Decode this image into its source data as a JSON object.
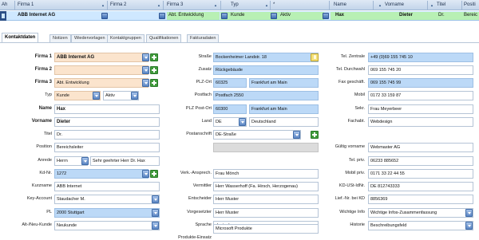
{
  "grid": {
    "columns": [
      {
        "key": "ah",
        "label": "Ah"
      },
      {
        "key": "firma1",
        "label": "Firma 1"
      },
      {
        "key": "firma2",
        "label": "Firma 2"
      },
      {
        "key": "firma3",
        "label": "Firma 3"
      },
      {
        "key": "typ",
        "label": "Typ"
      },
      {
        "key": "star",
        "label": "*"
      },
      {
        "key": "name",
        "label": "Name"
      },
      {
        "key": "vorname",
        "label": "Vorname"
      },
      {
        "key": "titel",
        "label": "Titel"
      },
      {
        "key": "position",
        "label": "Positi"
      }
    ],
    "row": {
      "firma1": "ABB Internet AG",
      "firma3": "Abt. Entwicklung",
      "typ": "Kunde",
      "status": "Aktiv",
      "name": "Hax",
      "vorname": "Dieter",
      "titel": "Dr.",
      "position": "Bereic"
    }
  },
  "tabs": [
    "Kontaktdaten",
    "Notizen",
    "Wiedervorlagen",
    "Kontaktgruppen",
    "Qualifikationen",
    "Fakturadaten"
  ],
  "form": {
    "labels": {
      "firma1": "Firma 1",
      "firma2": "Firma 2",
      "firma3": "Firma 3",
      "typ": "Typ",
      "name": "Name",
      "vorname": "Vorname",
      "titel": "Titel",
      "position": "Position",
      "anrede": "Anrede",
      "kdnr": "Kd-Nr.",
      "kurzname": "Kurzname",
      "keyaccount": "Key-Account",
      "pl": "PL",
      "altneukunde": "Alt-/Neu-Kunde",
      "strasse": "Straße",
      "zusatz": "Zusatz",
      "plzort": "PLZ-Ort",
      "postfach": "Postfach",
      "plzpostort": "PLZ Post-Ort",
      "land": "Land",
      "postanschrift": "Postanschrift",
      "verkansprech": "Verk.-Ansprech.",
      "vermittler": "Vermittler",
      "entscheider": "Entscheider",
      "vorgesetzter": "Vorgesetzter",
      "sprache": "Sprache",
      "produkteeinsatz": "Produkte-Einsatz",
      "telzentrale": "Tel. Zentrale",
      "teldurchwahl": "Tel. Durchwahl",
      "faxgeschaeft": "Fax geschäft.",
      "mobil": "Mobil",
      "sekr": "Sekr.",
      "fachabt": "Fachabt.",
      "gueltigvorname": "Gültig vorname",
      "telpriv": "Tel. priv.",
      "mobilpriv": "Mobil priv.",
      "kdustidnr": "KD-USt-IdNr.",
      "lieferdnr": "Lief.-Nr. bei KD",
      "wichtigeinfo": "Wichtige Info",
      "historie": "Historie"
    },
    "values": {
      "firma1": "ABB Internet AG",
      "firma2": "",
      "firma3": "Abt. Entwicklung",
      "typ": "Kunde",
      "status": "Aktiv",
      "name": "Hax",
      "vorname": "Dieter",
      "titel": "Dr.",
      "position": "Bereichsleiter",
      "anrede": "Herrn",
      "anrede_brief": "Sehr geehrter Herr Dr. Hax",
      "kdnr": "1272",
      "kurzname": "ABB Internet",
      "keyaccount": "Staudacher M.",
      "pl": "2000 Stuttgart",
      "altneukunde": "Neukunde",
      "strasse": "Bockenheimer Landstr. 18",
      "zusatz": "Rückgebäude",
      "plz": "60325",
      "ort": "Frankfurt am Main",
      "postfach": "Postfach 2550",
      "postplz": "60300",
      "postort": "Frankfurt am Main",
      "land_code": "DE",
      "land": "Deutschland",
      "postanschrift": "DE-Straße",
      "postanschrift_preview": "",
      "verkansprech": "Frau Mönch",
      "vermittler": "Herr Wasserhoff (Fa. Hirsch, Herzogenau)",
      "entscheider": "Herr Muster",
      "vorgesetzter": "Herr Muster",
      "sprache": "deutsch",
      "produkteeinsatz": "Microsoft Produkte",
      "telzentrale": "+49 (0)69 155 745 10",
      "teldurchwahl": "069 155 745 20",
      "faxgeschaeft": "069 155 745 99",
      "mobil": "0172 33 159 87",
      "sekr": "Frau Meyerbeer",
      "fachabt": "Webdesign",
      "gueltigvorname": "Webmaster AG",
      "telpriv": "06233 885652",
      "mobilpriv": "0171 33 22 44 55",
      "kdustidnr": "DE 812743333",
      "lieferdnr": "8856369",
      "wichtigeinfo": "Wichtige Infos-Zusammenfassung",
      "historie": "Beschreibungsfeld"
    }
  },
  "colors": {
    "header": "#c3d5ea",
    "selected_row": "#cfe8ff",
    "highlight_green": "#b8f0b4",
    "field_blue": "#bcd9f7",
    "field_peach": "#fbe4cd"
  }
}
